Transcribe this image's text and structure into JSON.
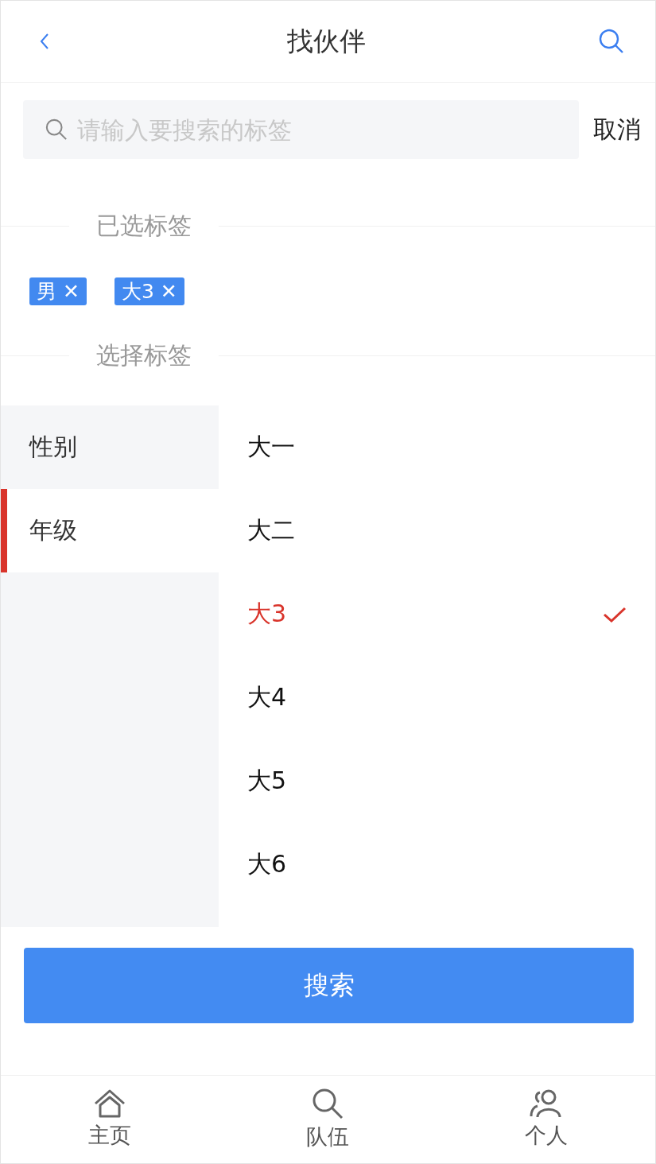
{
  "nav_bar": {
    "title": "找伙伴"
  },
  "search": {
    "placeholder": "请输入要搜索的标签",
    "cancel": "取消"
  },
  "selected_section": {
    "title": "已选标签",
    "tags": [
      {
        "label": "男",
        "remove": "✕"
      },
      {
        "label": "大3",
        "remove": "✕"
      }
    ]
  },
  "choose_section": {
    "title": "选择标签"
  },
  "categories": [
    {
      "label": "性别",
      "selected": false
    },
    {
      "label": "年级",
      "selected": true
    }
  ],
  "options": [
    {
      "label": "大一",
      "selected": false
    },
    {
      "label": "大二",
      "selected": false
    },
    {
      "label": "大3",
      "selected": true
    },
    {
      "label": "大4",
      "selected": false
    },
    {
      "label": "大5",
      "selected": false
    },
    {
      "label": "大6",
      "selected": false
    }
  ],
  "search_button": "搜索",
  "tab_bar": [
    {
      "label": "主页",
      "kind": "home"
    },
    {
      "label": "队伍",
      "kind": "search"
    },
    {
      "label": "个人",
      "kind": "people"
    }
  ]
}
